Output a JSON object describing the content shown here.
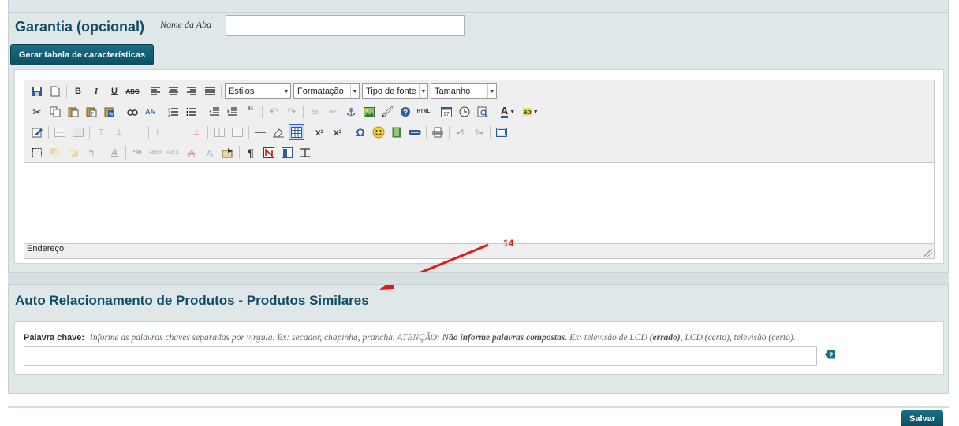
{
  "garantia": {
    "title": "Garantia (opcional)",
    "tab_name_label": "Nome da Aba",
    "tab_name_value": "",
    "generate_button": "Gerar tabela de características"
  },
  "editor": {
    "style_select": "Estilos",
    "format_select": "Formatação",
    "font_select": "Tipo de fonte",
    "size_select": "Tamanho",
    "status_label": "Endereço:",
    "content": ""
  },
  "annotation": {
    "number": "14",
    "color": "#e01b1b"
  },
  "auto_relacionamento": {
    "title": "Auto Relacionamento de Produtos - Produtos Similares",
    "keyword_label": "Palavra chave:",
    "hint_prefix": "Informe as palavras chaves separadas por virgula. Ex: secador, chapinha, prancha. ATENÇÃO:",
    "hint_bold": "Não informe palavras compostas.",
    "hint_ex": "Ex: televisão de LCD",
    "hint_wrong": "(errado)",
    "hint_suffix": ", LCD (certo), televisão (certo).",
    "keyword_value": ""
  },
  "footer": {
    "save_label": "Salvar"
  },
  "colors": {
    "title": "#124c68",
    "button": "#0d4f63",
    "panel": "#dfe7e9"
  }
}
